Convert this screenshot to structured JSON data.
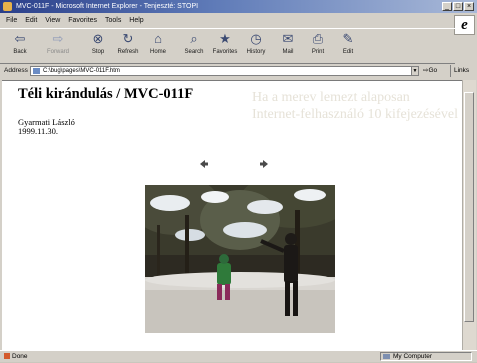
{
  "window": {
    "title": "MVC-011F - Microsoft Internet Explorer - Tenjeszté: STOPI",
    "controls": [
      "_",
      "□",
      "×"
    ]
  },
  "menu": [
    "File",
    "Edit",
    "View",
    "Favorites",
    "Tools",
    "Help"
  ],
  "toolbar": {
    "buttons": [
      {
        "label": "Back",
        "icon": "back-arrow-icon",
        "glyph": "⇦"
      },
      {
        "label": "Forward",
        "icon": "forward-arrow-icon",
        "glyph": "⇨",
        "disabled": true
      },
      {
        "label": "Stop",
        "icon": "stop-icon",
        "glyph": "⊗"
      },
      {
        "label": "Refresh",
        "icon": "refresh-icon",
        "glyph": "↻"
      },
      {
        "label": "Home",
        "icon": "home-icon",
        "glyph": "⌂"
      },
      {
        "label": "Search",
        "icon": "search-icon",
        "glyph": "⌕"
      },
      {
        "label": "Favorites",
        "icon": "favorites-icon",
        "glyph": "★"
      },
      {
        "label": "History",
        "icon": "history-icon",
        "glyph": "◷"
      },
      {
        "label": "Mail",
        "icon": "mail-icon",
        "glyph": "✉"
      },
      {
        "label": "Print",
        "icon": "print-icon",
        "glyph": "⎙"
      },
      {
        "label": "Edit",
        "icon": "edit-icon",
        "glyph": "✎"
      }
    ]
  },
  "address": {
    "label": "Address",
    "url": "C:\\bug\\pages\\MVC-011F.htm",
    "go_label": "⇨Go",
    "links_label": "Links"
  },
  "page": {
    "title": "Téli kirándulás / MVC-011F",
    "author": "Gyarmati László",
    "date": "1999.11.30.",
    "watermark_lines": [
      "Ha a merev lemezt alaposan",
      "Internet-felhasználó 10 kifejezésével"
    ]
  },
  "status": {
    "left": "Done",
    "zone": "My Computer"
  },
  "colors": {
    "titlebar_start": "#2a3f8a",
    "titlebar_end": "#a9b9d8",
    "chrome": "#d4d0c8"
  }
}
